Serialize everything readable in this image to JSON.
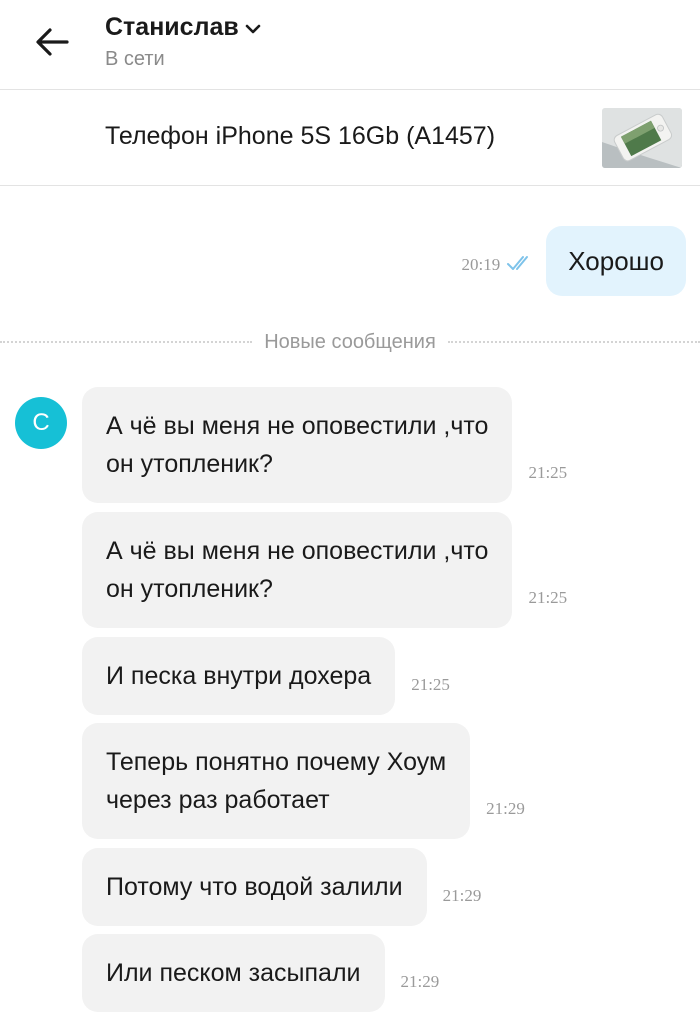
{
  "header": {
    "contact_name": "Станислав",
    "contact_status": "В сети"
  },
  "listing": {
    "title": "Телефон iPhone 5S 16Gb (A1457)"
  },
  "outgoing": {
    "text": "Хорошо",
    "time": "20:19",
    "read_status_icon": "double-check-icon",
    "check_color": "#7ec3ea"
  },
  "divider": {
    "label": "Новые сообщения"
  },
  "avatar": {
    "initial": "С",
    "color": "#16c0d6"
  },
  "messages": [
    {
      "lines": [
        "А чё вы меня не оповестили ,что",
        "он утопленик?"
      ],
      "time": "21:25"
    },
    {
      "lines": [
        "А чё вы меня не оповестили ,что",
        "он утопленик?"
      ],
      "time": "21:25"
    },
    {
      "lines": [
        "И песка внутри дохера"
      ],
      "time": "21:25"
    },
    {
      "lines": [
        "Теперь понятно почему Хоум",
        "через раз работает"
      ],
      "time": "21:29"
    },
    {
      "lines": [
        "Потому что водой залили"
      ],
      "time": "21:29"
    },
    {
      "lines": [
        "Или песком засыпали"
      ],
      "time": "21:29"
    }
  ]
}
